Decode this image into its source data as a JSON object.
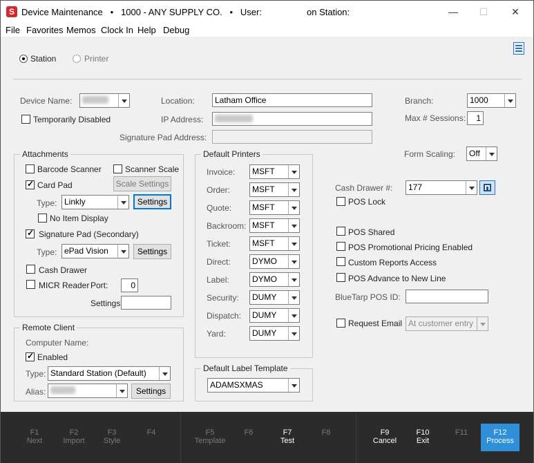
{
  "window": {
    "title": "Device Maintenance   •   1000 - ANY SUPPLY CO.   •   User:                  on Station:",
    "icon_letter": "S",
    "minimize": "—",
    "maximize": "☐",
    "close": "✕"
  },
  "menu": [
    "File",
    "Favorites",
    "Memos",
    "Clock In",
    "Help",
    "Debug"
  ],
  "mode": {
    "station": "Station",
    "printer": "Printer",
    "selected": "Station"
  },
  "device": {
    "device_name_label": "Device Name:",
    "temporarily_disabled": "Temporarily Disabled",
    "location_label": "Location:",
    "location_value": "Latham Office",
    "ip_label": "IP Address:",
    "signature_pad_label": "Signature Pad Address:",
    "branch_label": "Branch:",
    "branch_value": "1000",
    "max_sessions_label": "Max # Sessions:",
    "max_sessions_value": "1",
    "form_scaling_label": "Form Scaling:",
    "form_scaling_value": "Off"
  },
  "attachments": {
    "title": "Attachments",
    "barcode_scanner": "Barcode Scanner",
    "scanner_scale": "Scanner Scale",
    "card_pad": "Card Pad",
    "scale_settings": "Scale Settings",
    "type_label": "Type:",
    "card_pad_type": "Linkly",
    "settings": "Settings",
    "no_item_display": "No Item Display",
    "signature_pad": "Signature Pad (Secondary)",
    "signature_pad_type": "ePad Vision",
    "cash_drawer": "Cash Drawer",
    "micr_reader": "MICR Reader",
    "port_label": "Port:",
    "port_value": "0",
    "settings_label": "Settings:"
  },
  "default_printers": {
    "title": "Default Printers",
    "rows": [
      {
        "label": "Invoice:",
        "value": "MSFT"
      },
      {
        "label": "Order:",
        "value": "MSFT"
      },
      {
        "label": "Quote:",
        "value": "MSFT"
      },
      {
        "label": "Backroom:",
        "value": "MSFT"
      },
      {
        "label": "Ticket:",
        "value": "MSFT"
      },
      {
        "label": "Direct:",
        "value": "DYMO"
      },
      {
        "label": "Label:",
        "value": "DYMO"
      },
      {
        "label": "Security:",
        "value": "DUMY"
      },
      {
        "label": "Dispatch:",
        "value": "DUMY"
      },
      {
        "label": "Yard:",
        "value": "DUMY"
      }
    ]
  },
  "default_label_template": {
    "title": "Default Label Template",
    "value": "ADAMSXMAS"
  },
  "remote_client": {
    "title": "Remote Client",
    "computer_name_label": "Computer Name:",
    "enabled": "Enabled",
    "type_label": "Type:",
    "type_value": "Standard Station (Default)",
    "alias_label": "Alias:",
    "settings": "Settings"
  },
  "right_panel": {
    "cash_drawer_label": "Cash Drawer #:",
    "cash_drawer_value": "177",
    "pos_lock": "POS Lock",
    "pos_shared": "POS Shared",
    "pos_promo": "POS Promotional Pricing Enabled",
    "custom_reports": "Custom Reports Access",
    "pos_advance": "POS Advance to New Line",
    "bluetarp_label": "BlueTarp POS ID:",
    "request_email": "Request Email",
    "request_email_value": "At customer entry"
  },
  "fkeys": [
    {
      "key": "F1",
      "label": "Next",
      "state": "off"
    },
    {
      "key": "F2",
      "label": "Import",
      "state": "off"
    },
    {
      "key": "F3",
      "label": "Style",
      "state": "off"
    },
    {
      "key": "F4",
      "label": "",
      "state": "off"
    },
    {
      "key": "F5",
      "label": "Template",
      "state": "off"
    },
    {
      "key": "F6",
      "label": "",
      "state": "off"
    },
    {
      "key": "F7",
      "label": "Test",
      "state": "on"
    },
    {
      "key": "F8",
      "label": "",
      "state": "off"
    },
    {
      "key": "F9",
      "label": "Cancel",
      "state": "on"
    },
    {
      "key": "F10",
      "label": "Exit",
      "state": "on"
    },
    {
      "key": "F11",
      "label": "",
      "state": "off"
    },
    {
      "key": "F12",
      "label": "Process",
      "state": "primary"
    }
  ]
}
